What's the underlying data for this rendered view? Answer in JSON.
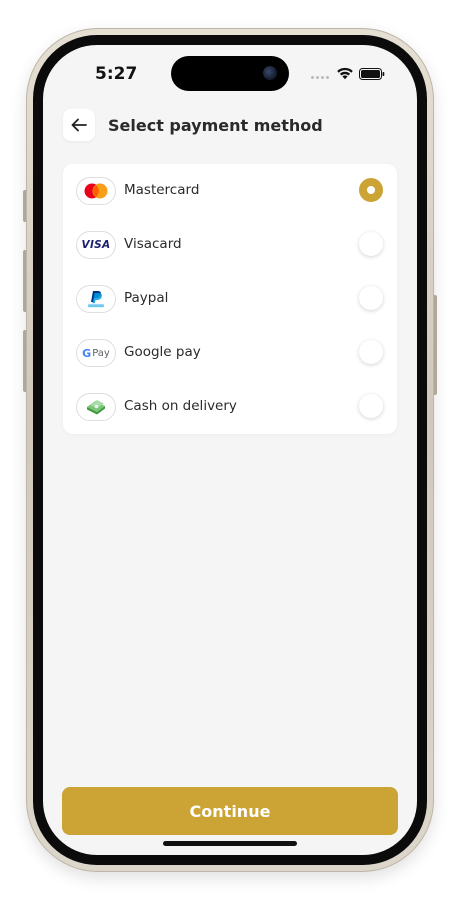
{
  "status_bar": {
    "time": "5:27"
  },
  "header": {
    "back_icon": "arrow-left-icon",
    "title": "Select payment method"
  },
  "payment_methods": [
    {
      "label": "Mastercard",
      "icon": "mastercard-logo-icon",
      "selected": true
    },
    {
      "label": "Visacard",
      "icon": "visa-logo-icon",
      "logo_text": "VISA",
      "selected": false
    },
    {
      "label": "Paypal",
      "icon": "paypal-logo-icon",
      "selected": false
    },
    {
      "label": "Google pay",
      "icon": "google-pay-logo-icon",
      "logo_text": "Pay",
      "selected": false
    },
    {
      "label": "Cash on delivery",
      "icon": "cash-icon",
      "selected": false
    }
  ],
  "continue_label": "Continue",
  "colors": {
    "accent": "#cca435",
    "background": "#f5f5f5",
    "card": "#ffffff",
    "text": "#2a2a2a"
  }
}
